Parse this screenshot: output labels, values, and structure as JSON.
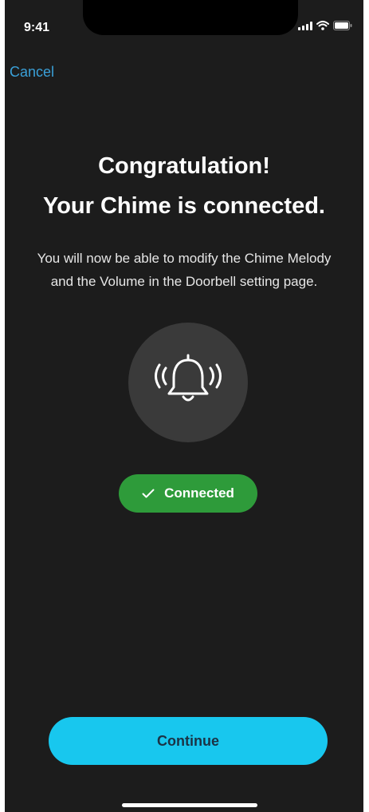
{
  "status_bar": {
    "time": "9:41",
    "signal_icon": "cellular-signal-icon",
    "wifi_icon": "wifi-icon",
    "battery_icon": "battery-icon"
  },
  "nav": {
    "cancel_label": "Cancel"
  },
  "main": {
    "title_line_1": "Congratulation!",
    "title_line_2": "Your Chime is connected.",
    "description": "You will now be able to modify the Chime Melody and the Volume in the Doorbell setting page.",
    "icon": "ringing-bell-icon",
    "status_badge": {
      "icon": "check-icon",
      "label": "Connected"
    }
  },
  "footer": {
    "continue_label": "Continue"
  },
  "colors": {
    "background": "#1c1c1c",
    "accent_link": "#3aa0d8",
    "success": "#2e9b3a",
    "primary_button": "#18c7ee",
    "primary_button_text": "#1b3345",
    "icon_circle": "#3a3a3a"
  }
}
